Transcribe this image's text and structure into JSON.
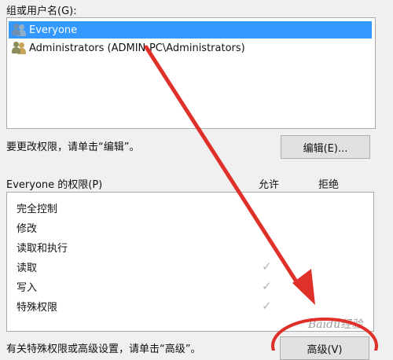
{
  "group_label": "组或用户名(G):",
  "users": [
    {
      "name": "Everyone",
      "selected": true,
      "icon": "users-group-icon"
    },
    {
      "name": "Administrators (ADMIN-PC\\Administrators)",
      "selected": false,
      "icon": "admin-group-icon"
    }
  ],
  "change_hint": "要更改权限，请单击“编辑”。",
  "edit_button": "编辑(E)...",
  "perm_header": {
    "title": "Everyone 的权限(P)",
    "allow": "允许",
    "deny": "拒绝"
  },
  "permissions": [
    {
      "name": "完全控制",
      "allow_checked": false
    },
    {
      "name": "修改",
      "allow_checked": false
    },
    {
      "name": "读取和执行",
      "allow_checked": false
    },
    {
      "name": "读取",
      "allow_checked": true
    },
    {
      "name": "写入",
      "allow_checked": true
    },
    {
      "name": "特殊权限",
      "allow_checked": true
    }
  ],
  "advanced_hint": "有关特殊权限或高级设置，请单击“高级”。",
  "advanced_button": "高级(V)",
  "watermark": "Baidu经验",
  "colors": {
    "selection": "#3399ff",
    "annotation_red": "#e0302a"
  }
}
